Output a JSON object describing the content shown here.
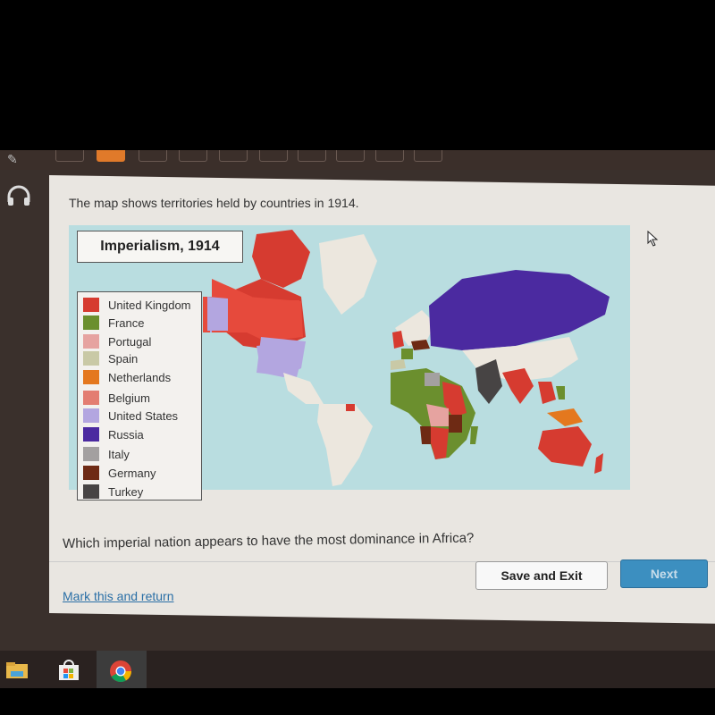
{
  "prompt": "The map shows territories held by countries in 1914.",
  "map": {
    "title": "Imperialism, 1914",
    "legend": [
      {
        "label": "United Kingdom",
        "color": "#d63b30"
      },
      {
        "label": "France",
        "color": "#6b8f2e"
      },
      {
        "label": "Portugal",
        "color": "#e6a3a0"
      },
      {
        "label": "Spain",
        "color": "#c9c9a6"
      },
      {
        "label": "Netherlands",
        "color": "#e4781e"
      },
      {
        "label": "Belgium",
        "color": "#e37d72"
      },
      {
        "label": "United States",
        "color": "#b3a6e0"
      },
      {
        "label": "Russia",
        "color": "#4b2aa0"
      },
      {
        "label": "Italy",
        "color": "#a3a0a0"
      },
      {
        "label": "Germany",
        "color": "#6e2a14"
      },
      {
        "label": "Turkey",
        "color": "#474444"
      }
    ]
  },
  "question": "Which imperial nation appears to have the most dominance in Africa?",
  "buttons": {
    "save_exit": "Save and Exit",
    "next": "Next",
    "mark_return": "Mark this and return"
  },
  "icons": {
    "pencil": "✎",
    "headphones": "🎧",
    "cursor": "⇖"
  },
  "taskbar": [
    "file-explorer",
    "microsoft-store",
    "chrome"
  ]
}
